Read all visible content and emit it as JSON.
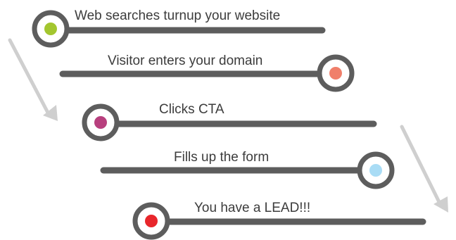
{
  "colors": {
    "bar": "#5d5d5d",
    "ring": "#5d5d5d",
    "arrow": "#cfcfcf",
    "background": "#ffffff"
  },
  "steps": [
    {
      "label": "Web searches turnup your website",
      "dot_color": "#a3c62f"
    },
    {
      "label": "Visitor enters your domain",
      "dot_color": "#f07f6a"
    },
    {
      "label": "Clicks CTA",
      "dot_color": "#b8407e"
    },
    {
      "label": "Fills up the form",
      "dot_color": "#a9dcf5"
    },
    {
      "label": "You have a LEAD!!!",
      "dot_color": "#e8262b"
    }
  ]
}
